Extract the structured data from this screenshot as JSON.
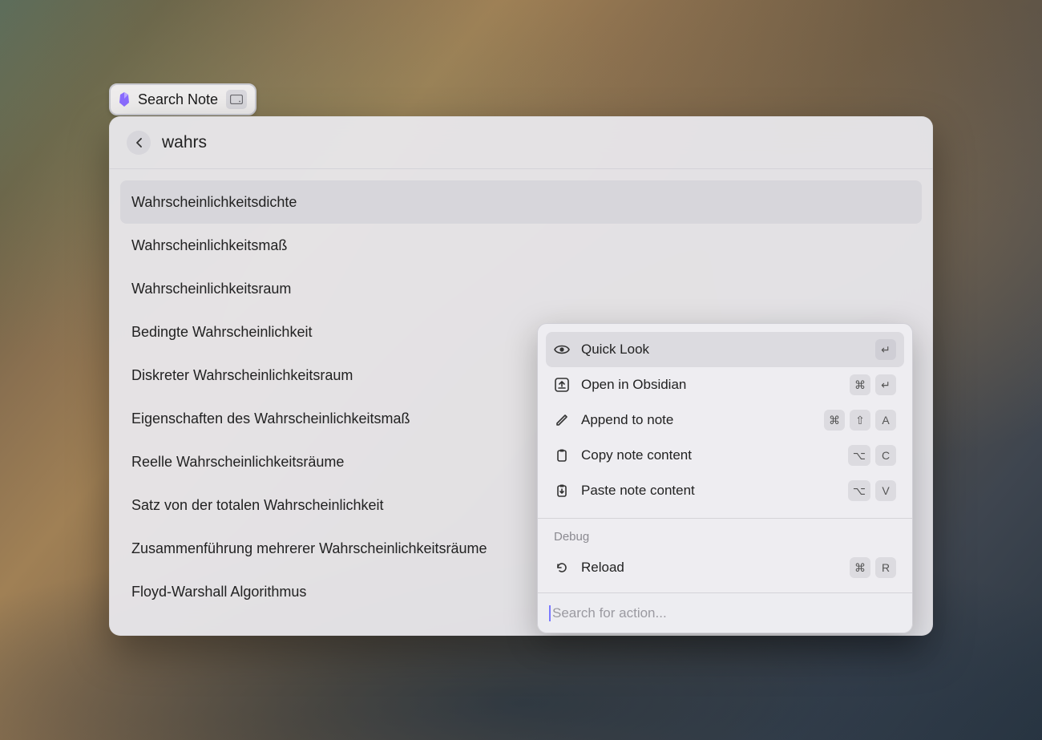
{
  "breadcrumb": {
    "label": "Search Note"
  },
  "search": {
    "value": "wahrs"
  },
  "results": [
    {
      "title": "Wahrscheinlichkeitsdichte",
      "selected": true
    },
    {
      "title": "Wahrscheinlichkeitsmaß",
      "selected": false
    },
    {
      "title": "Wahrscheinlichkeitsraum",
      "selected": false
    },
    {
      "title": "Bedingte Wahrscheinlichkeit",
      "selected": false
    },
    {
      "title": "Diskreter Wahrscheinlichkeitsraum",
      "selected": false
    },
    {
      "title": "Eigenschaften des Wahrscheinlichkeitsmaß",
      "selected": false
    },
    {
      "title": "Reelle Wahrscheinlichkeitsräume",
      "selected": false
    },
    {
      "title": "Satz von der totalen Wahrscheinlichkeit",
      "selected": false
    },
    {
      "title": "Zusammenführung mehrerer Wahrscheinlichkeitsräume",
      "selected": false
    },
    {
      "title": "Floyd-Warshall Algorithmus",
      "selected": false
    }
  ],
  "actions": {
    "items": [
      {
        "icon": "eye",
        "label": "Quick Look",
        "keys": [
          "↵"
        ],
        "selected": true
      },
      {
        "icon": "open-external",
        "label": "Open in Obsidian",
        "keys": [
          "⌘",
          "↵"
        ],
        "selected": false
      },
      {
        "icon": "pencil",
        "label": "Append to note",
        "keys": [
          "⌘",
          "⇧",
          "A"
        ],
        "selected": false
      },
      {
        "icon": "clipboard-copy",
        "label": "Copy note content",
        "keys": [
          "⌥",
          "C"
        ],
        "selected": false
      },
      {
        "icon": "clipboard-paste",
        "label": "Paste note content",
        "keys": [
          "⌥",
          "V"
        ],
        "selected": false
      }
    ],
    "debug_section_title": "Debug",
    "debug_items": [
      {
        "icon": "reload",
        "label": "Reload",
        "keys": [
          "⌘",
          "R"
        ],
        "selected": false
      }
    ],
    "search_placeholder": "Search for action..."
  }
}
